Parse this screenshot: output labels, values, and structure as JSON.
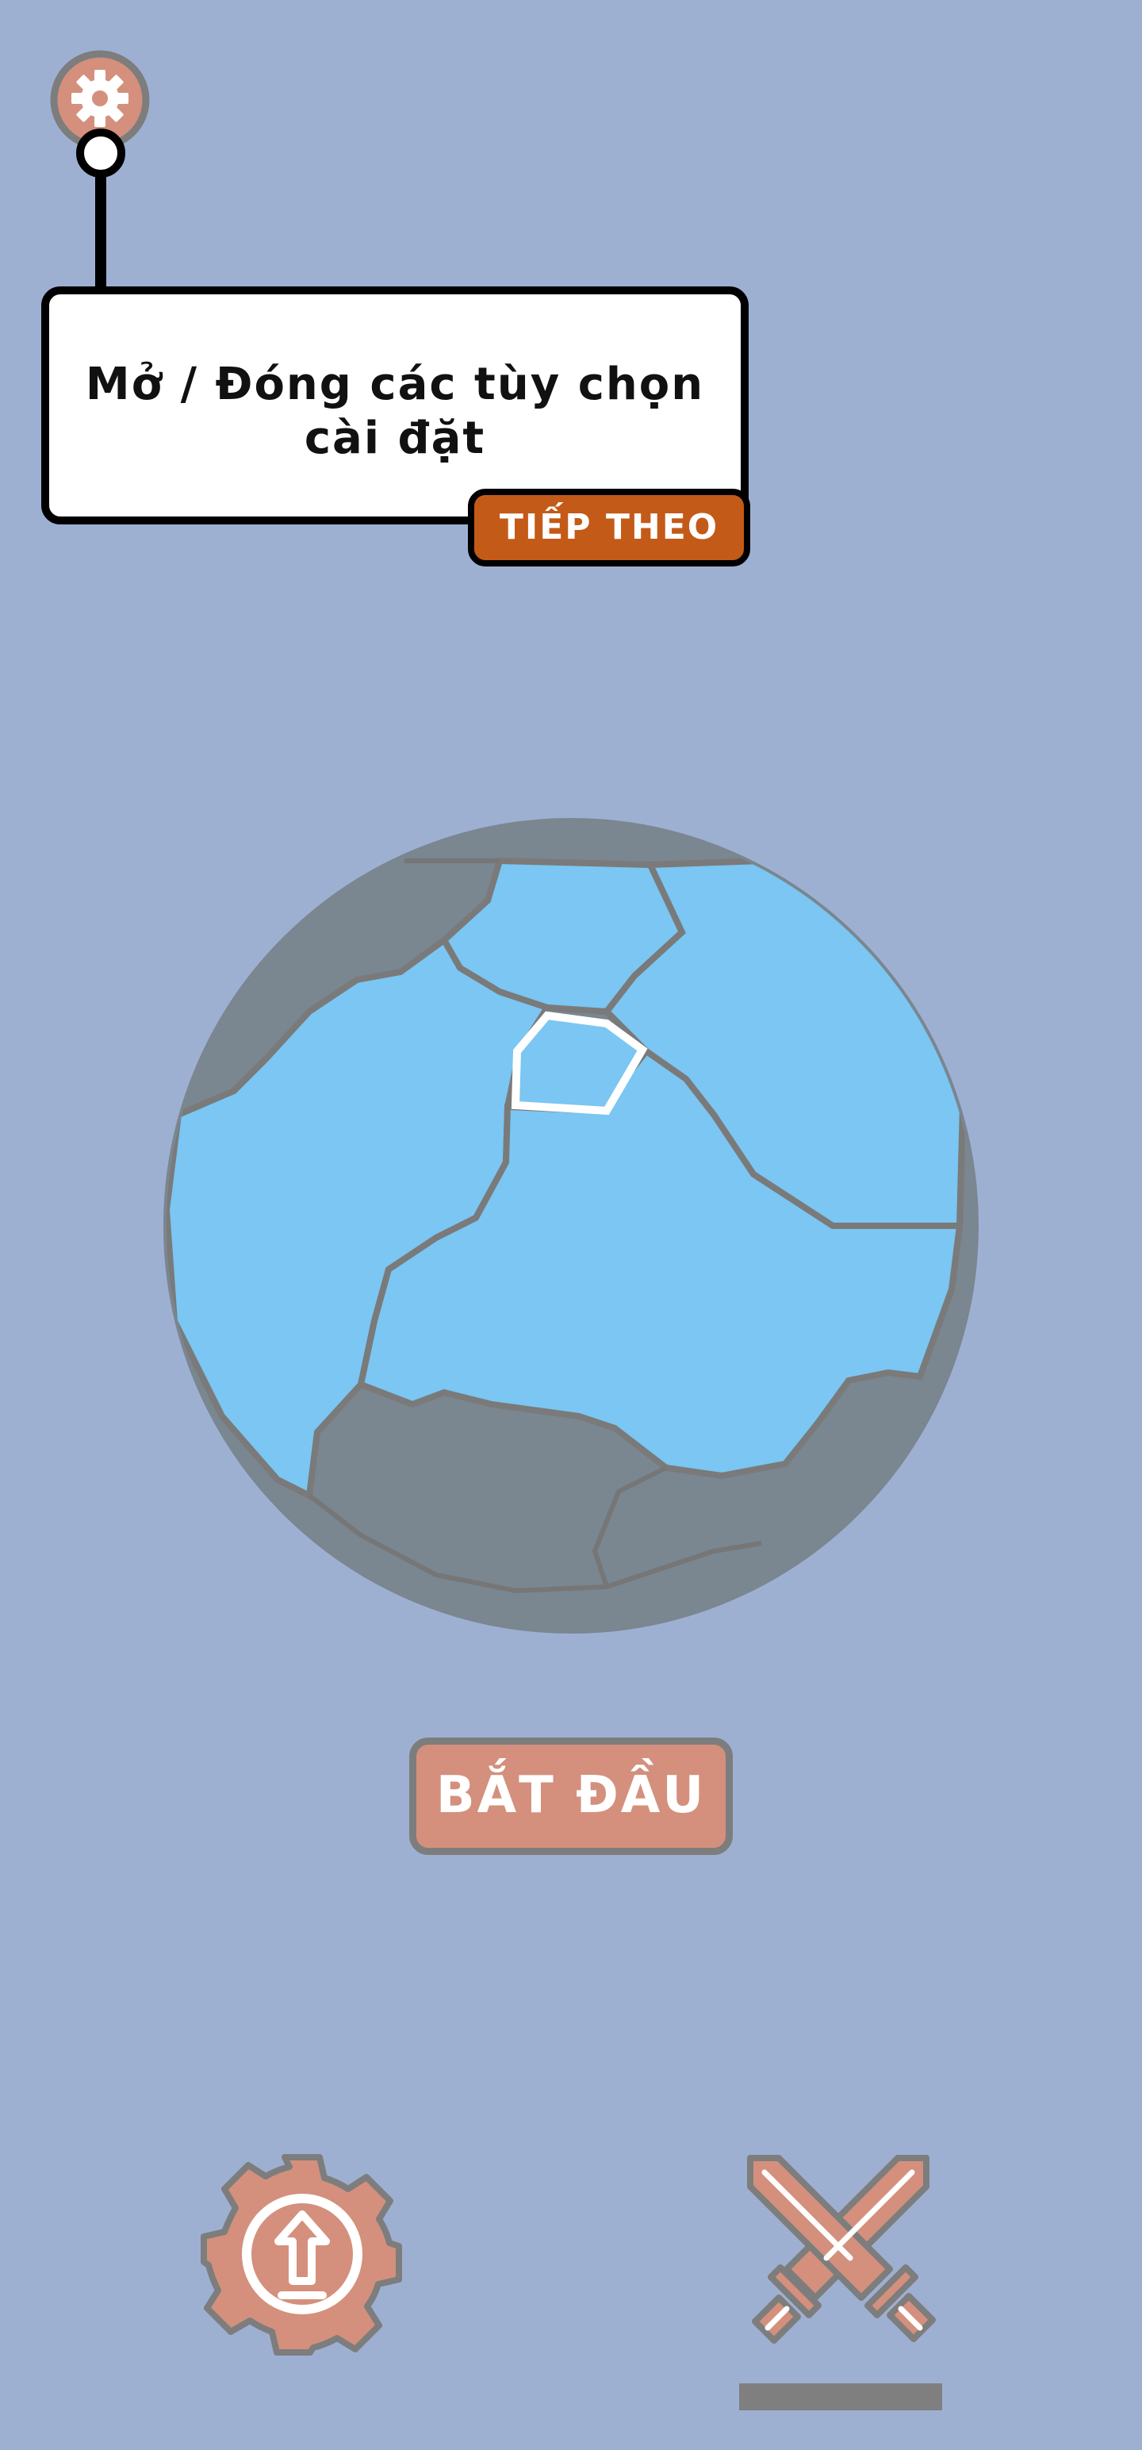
{
  "tutorial": {
    "message": "Mở / Đóng các tùy chọn cài đặt",
    "next_label": "TIẾP THEO"
  },
  "main": {
    "start_label": "BẮT ĐẦU"
  },
  "icons": {
    "settings": "gear-icon",
    "upgrade": "gear-upgrade-icon",
    "battle": "crossed-swords-icon"
  },
  "bottom_nav": {
    "active_tab": "battle"
  },
  "colors": {
    "background": "#9eb0d2",
    "ocean": "#7bc6f2",
    "land": "#7a8690",
    "accent": "#d4907d",
    "next_button": "#c45a18",
    "outline": "#7d7d7d"
  }
}
